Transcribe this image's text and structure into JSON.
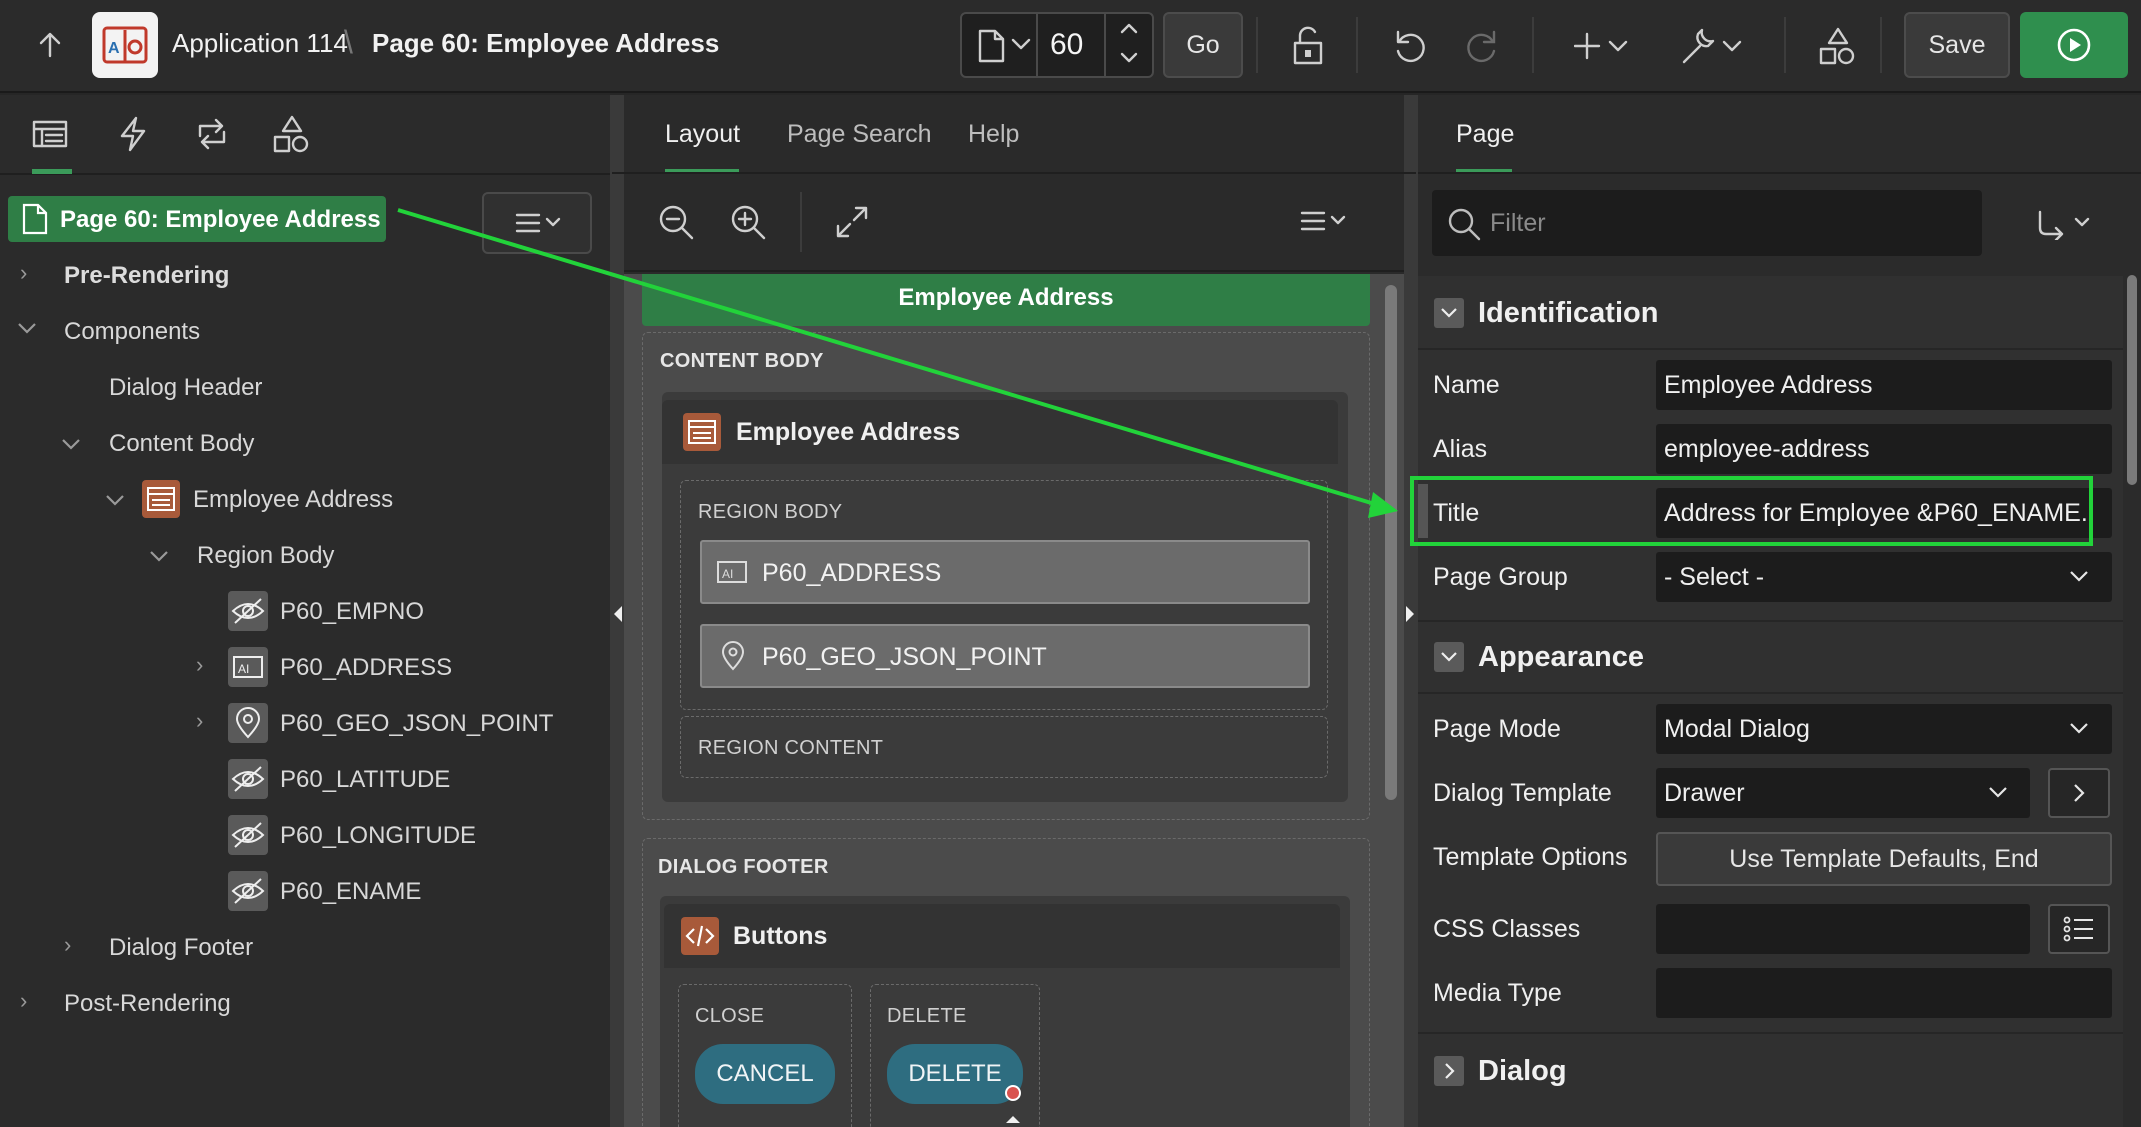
{
  "header": {
    "app_name": "Application 114",
    "page_name": "Page 60: Employee Address",
    "page_number": "60",
    "go_label": "Go",
    "save_label": "Save"
  },
  "left": {
    "tree": {
      "page": "Page 60: Employee Address",
      "pre_rendering": "Pre-Rendering",
      "components": "Components",
      "dialog_header": "Dialog Header",
      "content_body": "Content Body",
      "region": "Employee Address",
      "region_body": "Region Body",
      "items": [
        "P60_EMPNO",
        "P60_ADDRESS",
        "P60_GEO_JSON_POINT",
        "P60_LATITUDE",
        "P60_LONGITUDE",
        "P60_ENAME"
      ],
      "dialog_footer": "Dialog Footer",
      "post_rendering": "Post-Rendering"
    }
  },
  "middle": {
    "tabs": [
      "Layout",
      "Page Search",
      "Help"
    ],
    "dialog_header": "Employee Address",
    "content_body_label": "CONTENT BODY",
    "region_title": "Employee Address",
    "region_body_label": "REGION BODY",
    "fields": [
      "P60_ADDRESS",
      "P60_GEO_JSON_POINT"
    ],
    "region_content_label": "REGION CONTENT",
    "dialog_footer_label": "DIALOG FOOTER",
    "buttons_region": "Buttons",
    "close_slot": "CLOSE",
    "delete_slot": "DELETE",
    "cancel_button": "CANCEL",
    "delete_button": "DELETE"
  },
  "right": {
    "tab": "Page",
    "filter_placeholder": "Filter",
    "identification": {
      "title": "Identification",
      "name_label": "Name",
      "name_value": "Employee Address",
      "alias_label": "Alias",
      "alias_value": "employee-address",
      "title_label": "Title",
      "title_value": "Address for Employee &P60_ENAME.",
      "group_label": "Page Group",
      "group_value": "- Select -"
    },
    "appearance": {
      "title": "Appearance",
      "mode_label": "Page Mode",
      "mode_value": "Modal Dialog",
      "template_label": "Dialog Template",
      "template_value": "Drawer",
      "options_label": "Template Options",
      "options_value": "Use Template Defaults, End",
      "css_label": "CSS Classes",
      "css_value": "",
      "media_label": "Media Type",
      "media_value": ""
    },
    "dialog": {
      "title": "Dialog"
    }
  },
  "colors": {
    "accent_green": "#2f7e46",
    "highlight_green": "#22d33a",
    "button_teal": "#2e6d80",
    "region_icon": "#a85a3a"
  }
}
